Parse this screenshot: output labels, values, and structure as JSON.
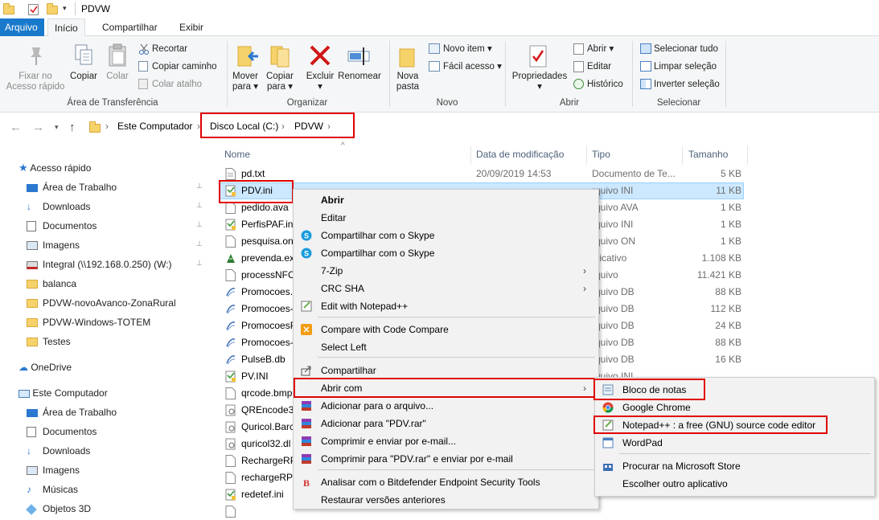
{
  "window": {
    "title": "PDVW"
  },
  "tabs": [
    "Arquivo",
    "Início",
    "Compartilhar",
    "Exibir"
  ],
  "ribbon": {
    "clipboard": {
      "pin": "Fixar no\nAcesso rápido",
      "copy": "Copiar",
      "paste": "Colar",
      "cut": "Recortar",
      "copy_path": "Copiar caminho",
      "paste_shortcut": "Colar atalho",
      "label": "Área de Transferência"
    },
    "organize": {
      "move": "Mover\npara ▾",
      "copy_to": "Copiar\npara ▾",
      "delete": "Excluir\n▾",
      "rename": "Renomear",
      "label": "Organizar"
    },
    "new": {
      "new_folder": "Nova\npasta",
      "new_item": "Novo item ▾",
      "easy_access": "Fácil acesso ▾",
      "label": "Novo"
    },
    "open": {
      "properties": "Propriedades\n▾",
      "open": "Abrir ▾",
      "edit": "Editar",
      "history": "Histórico",
      "label": "Abrir"
    },
    "select": {
      "select_all": "Selecionar tudo",
      "select_none": "Limpar seleção",
      "invert": "Inverter seleção",
      "label": "Selecionar"
    }
  },
  "address": {
    "crumbs": [
      "Este Computador",
      "Disco Local (C:)",
      "PDVW"
    ]
  },
  "navigation": {
    "quick_access": "Acesso rápido",
    "quick_items": [
      "Área de Trabalho",
      "Downloads",
      "Documentos",
      "Imagens",
      "Integral (\\\\192.168.0.250) (W:)",
      "balanca",
      "PDVW-novoAvanco-ZonaRural",
      "PDVW-Windows-TOTEM",
      "Testes"
    ],
    "onedrive": "OneDrive",
    "this_pc": "Este Computador",
    "pc_items": [
      "Área de Trabalho",
      "Documentos",
      "Downloads",
      "Imagens",
      "Músicas",
      "Objetos 3D"
    ]
  },
  "columns": {
    "name": "Nome",
    "date": "Data de modificação",
    "type": "Tipo",
    "size": "Tamanho"
  },
  "files": [
    {
      "name": "pd.txt",
      "date": "20/09/2019 14:53",
      "type": "Documento de Te...",
      "size": "5 KB",
      "icon": "txt-icon"
    },
    {
      "name": "PDV.ini",
      "date": "",
      "type": "rquivo INI",
      "size": "11 KB",
      "icon": "ini-icon"
    },
    {
      "name": "pedido.ava",
      "date": "",
      "type": "rquivo AVA",
      "size": "1 KB",
      "icon": "file-icon"
    },
    {
      "name": "PerfisPAF.ini",
      "date": "",
      "type": "rquivo INI",
      "size": "1 KB",
      "icon": "ini-icon"
    },
    {
      "name": "pesquisa.on",
      "date": "",
      "type": "rquivo ON",
      "size": "1 KB",
      "icon": "file-icon"
    },
    {
      "name": "prevenda.ex",
      "date": "",
      "type": "plicativo",
      "size": "1.108 KB",
      "icon": "exe-icon"
    },
    {
      "name": "processNFC",
      "date": "",
      "type": "rquivo",
      "size": "11.421 KB",
      "icon": "file-icon"
    },
    {
      "name": "Promocoes.",
      "date": "",
      "type": "rquivo DB",
      "size": "88 KB",
      "icon": "db-icon"
    },
    {
      "name": "Promocoes-",
      "date": "",
      "type": "rquivo DB",
      "size": "112 KB",
      "icon": "db-icon"
    },
    {
      "name": "PromocoesP",
      "date": "",
      "type": "rquivo DB",
      "size": "24 KB",
      "icon": "db-icon"
    },
    {
      "name": "Promocoes-",
      "date": "",
      "type": "rquivo DB",
      "size": "88 KB",
      "icon": "db-icon"
    },
    {
      "name": "PulseB.db",
      "date": "",
      "type": "rquivo DB",
      "size": "16 KB",
      "icon": "db-icon"
    },
    {
      "name": "PV.INI",
      "date": "",
      "type": "rquivo INI",
      "size": "",
      "icon": "ini-icon"
    },
    {
      "name": "qrcode.bmp",
      "date": "",
      "type": "",
      "size": "",
      "icon": "file-icon"
    },
    {
      "name": "QREncode32",
      "date": "",
      "type": "",
      "size": "",
      "icon": "dll-icon"
    },
    {
      "name": "Quricol.Barc",
      "date": "",
      "type": "",
      "size": "",
      "icon": "dll-icon"
    },
    {
      "name": "quricol32.dl",
      "date": "",
      "type": "",
      "size": "",
      "icon": "dll-icon"
    },
    {
      "name": "RechargeRP",
      "date": "",
      "type": "",
      "size": "",
      "icon": "file-icon"
    },
    {
      "name": "rechargeRPC",
      "date": "",
      "type": "",
      "size": "",
      "icon": "file-icon"
    },
    {
      "name": "redetef.ini",
      "date": "",
      "type": "",
      "size": "",
      "icon": "ini-icon"
    },
    {
      "name": "",
      "date": "",
      "type": "",
      "size": "",
      "icon": "file-icon"
    }
  ],
  "context_menu": {
    "items": [
      {
        "label": "Abrir",
        "bold": true,
        "icon": ""
      },
      {
        "label": "Editar",
        "icon": ""
      },
      {
        "label": "Compartilhar com o Skype",
        "icon": "skype-icon"
      },
      {
        "label": "Compartilhar com o Skype",
        "icon": "skype-icon"
      },
      {
        "label": "7-Zip",
        "icon": "",
        "submenu": true
      },
      {
        "label": "CRC SHA",
        "icon": "",
        "submenu": true
      },
      {
        "label": "Edit with Notepad++",
        "icon": "notepadpp-icon"
      },
      {
        "label": "Compare with Code Compare",
        "icon": "codecompare-icon"
      },
      {
        "label": "Select Left",
        "icon": ""
      },
      {
        "label": "Compartilhar",
        "icon": "share-icon"
      },
      {
        "label": "Abrir com",
        "icon": "",
        "submenu": true
      },
      {
        "label": "Adicionar para o arquivo...",
        "icon": "winrar-icon"
      },
      {
        "label": "Adicionar para \"PDV.rar\"",
        "icon": "winrar-icon"
      },
      {
        "label": "Comprimir e enviar por e-mail...",
        "icon": "winrar-icon"
      },
      {
        "label": "Comprimir para \"PDV.rar\" e enviar por e-mail",
        "icon": "winrar-icon"
      },
      {
        "label": "Analisar com o Bitdefender Endpoint Security Tools",
        "icon": "bitdefender-icon"
      },
      {
        "label": "Restaurar versões anteriores",
        "icon": ""
      }
    ]
  },
  "open_with_menu": {
    "items": [
      {
        "label": "Bloco de notas",
        "icon": "notepad-icon"
      },
      {
        "label": "Google Chrome",
        "icon": "chrome-icon"
      },
      {
        "label": "Notepad++ : a free (GNU) source code editor",
        "icon": "notepadpp-icon"
      },
      {
        "label": "WordPad",
        "icon": "wordpad-icon"
      },
      {
        "label": "Procurar na Microsoft Store",
        "icon": "store-icon"
      },
      {
        "label": "Escolher outro aplicativo",
        "icon": ""
      }
    ]
  },
  "colors": {
    "accent": "#1979ca",
    "selection": "#cce8ff",
    "highlight_box": "#e00000",
    "folder": "#f6d36a"
  }
}
